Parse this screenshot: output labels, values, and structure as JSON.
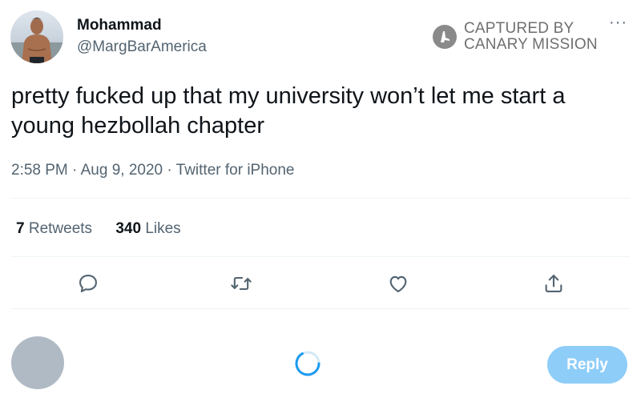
{
  "author": {
    "display_name": "Mohammad",
    "handle": "@MargBarAmerica"
  },
  "watermark": {
    "line1": "CAPTURED BY",
    "line2": "CANARY MISSION",
    "icon": "canary-logo-icon"
  },
  "tweet": {
    "text": "pretty fucked up that my university won’t let me start a young hezbollah chapter",
    "time": "2:58 PM",
    "date": "Aug 9, 2020",
    "source": "Twitter for iPhone",
    "separator": "·"
  },
  "stats": {
    "retweets_count": "7",
    "retweets_label": "Retweets",
    "likes_count": "340",
    "likes_label": "Likes"
  },
  "actions": [
    "reply-icon",
    "retweet-icon",
    "like-icon",
    "share-icon"
  ],
  "more_menu": {
    "glyph": "···"
  },
  "composer": {
    "reply_label": "Reply"
  },
  "colors": {
    "text": "#0f1419",
    "secondary": "#536471",
    "accent": "#1d9bf0",
    "reply_button_disabled": "#8ecdf8"
  }
}
